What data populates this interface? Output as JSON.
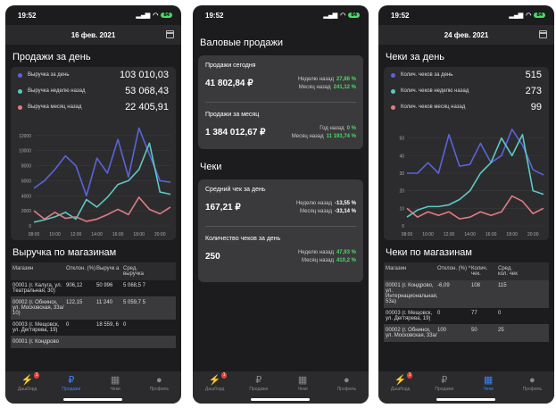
{
  "status": {
    "time": "19:52"
  },
  "colors": {
    "blue": "#5a63d8",
    "teal": "#5cc9c0",
    "red": "#e07b84",
    "green": "#4cd964"
  },
  "screen1": {
    "date": "16 фев. 2021",
    "title": "Продажи за день",
    "legend": [
      {
        "label": "Выручка за день",
        "value": "103 010,03"
      },
      {
        "label": "Выручка неделю назад",
        "value": "53 068,43"
      },
      {
        "label": "Выручка месяц назад",
        "value": "22 405,91"
      }
    ],
    "stores_title": "Выручка по магазинам",
    "table_headers": [
      "Магазин",
      "Отклон. (%)",
      "Выручк а",
      "Сред. выручка"
    ],
    "rows": [
      [
        "00001 (г. Калуга, ул. Театральная, 30)",
        "906,12",
        "50 996",
        "5 068,5 7"
      ],
      [
        "00002 (г. Обнинск, ул. Московская, 33а/ 10)",
        "122,15",
        "11 240",
        "5 059,7 5"
      ],
      [
        "00003 (г. Мещовск, ул. Дегтярева, 19)",
        "0",
        "18 559, 6",
        "0"
      ],
      [
        "00001 (г. Кондрово",
        "",
        "",
        ""
      ]
    ]
  },
  "chart1": {
    "type": "line",
    "x": [
      "08:00",
      "09:00",
      "10:00",
      "11:00",
      "12:00",
      "13:00",
      "14:00",
      "15:00",
      "16:00",
      "17:00",
      "18:00",
      "19:00",
      "20:00",
      "21:00"
    ],
    "ylim": [
      0,
      14000
    ],
    "yticks": [
      "0",
      "2000",
      "4000",
      "6000",
      "8000",
      "10000",
      "12000"
    ],
    "xticks": [
      "08:00",
      "10:00",
      "12:00",
      "14:00",
      "16:00",
      "18:00",
      "20:00"
    ],
    "series": [
      {
        "name": "Выручка за день",
        "values": [
          5000,
          6000,
          7500,
          9300,
          8000,
          4000,
          9000,
          7000,
          11500,
          6500,
          13000,
          9500,
          6000,
          5800
        ]
      },
      {
        "name": "Выручка неделю назад",
        "values": [
          500,
          800,
          1200,
          1800,
          900,
          3500,
          2500,
          3800,
          5500,
          6000,
          7500,
          11000,
          4500,
          4200
        ]
      },
      {
        "name": "Выручка месяц назад",
        "values": [
          2000,
          900,
          1800,
          1000,
          1200,
          600,
          900,
          1500,
          2200,
          1500,
          3800,
          2200,
          1600,
          2500
        ]
      }
    ]
  },
  "screen2": {
    "gross_title": "Валовые продажи",
    "today": {
      "title": "Продажи сегодня",
      "value": "41 802,84 ₽",
      "week_label": "Неделю назад",
      "week_val": "27,86 %",
      "month_label": "Месяц назад",
      "month_val": "241,12 %"
    },
    "month": {
      "title": "Продажи за месяц",
      "value": "1 384 012,67 ₽",
      "year_label": "Год назад",
      "year_val": "0 %",
      "month_label": "Месяц назад",
      "month_val": "11 193,74 %"
    },
    "checks_title": "Чеки",
    "avg": {
      "title": "Средний чек за день",
      "value": "167,21 ₽",
      "week_label": "Неделю назад",
      "week_val": "-13,55 %",
      "month_label": "Месяц назад",
      "month_val": "-33,14 %"
    },
    "count": {
      "title": "Количество чеков за день",
      "value": "250",
      "week_label": "Неделю назад",
      "week_val": "47,93 %",
      "month_label": "Месяц назад",
      "month_val": "410,2 %"
    }
  },
  "screen3": {
    "date": "24 фев. 2021",
    "title": "Чеки за день",
    "legend": [
      {
        "label": "Колич. чеков за день",
        "value": "515"
      },
      {
        "label": "Колич. чеков неделю назад",
        "value": "273"
      },
      {
        "label": "Колич. чеков месяц назад",
        "value": "99"
      }
    ],
    "stores_title": "Чеки по магазинам",
    "table_headers": [
      "Магазин",
      "Отклон. (%) ^",
      "Колич. чек.",
      "Сред. кол. чек"
    ],
    "rows": [
      [
        "00001 (г. Кондрово, ул. Интернациональная, 53а)",
        "-6,09",
        "108",
        "115"
      ],
      [
        "00003 (г. Мещовск, ул. Дегтярева, 19)",
        "0",
        "77",
        "0"
      ],
      [
        "00002 (г. Обнинск, ул. Московская, 33а/",
        "100",
        "50",
        "25"
      ]
    ]
  },
  "chart3": {
    "type": "line",
    "x": [
      "08:00",
      "09:00",
      "10:00",
      "11:00",
      "12:00",
      "13:00",
      "14:00",
      "15:00",
      "16:00",
      "17:00",
      "18:00",
      "19:00",
      "20:00",
      "21:00"
    ],
    "ylim": [
      0,
      60
    ],
    "yticks": [
      "0",
      "10",
      "20",
      "30",
      "40",
      "50"
    ],
    "xticks": [
      "08:00",
      "10:00",
      "12:00",
      "14:00",
      "16:00",
      "18:00",
      "20:00"
    ],
    "series": [
      {
        "name": "Колич. чеков за день",
        "values": [
          30,
          30,
          36,
          30,
          52,
          34,
          35,
          47,
          36,
          40,
          55,
          46,
          32,
          29
        ]
      },
      {
        "name": "Колич. чеков неделю назад",
        "values": [
          5,
          9,
          11,
          11,
          12,
          15,
          20,
          30,
          36,
          50,
          40,
          52,
          20,
          18
        ]
      },
      {
        "name": "Колич. чеков месяц назад",
        "values": [
          10,
          5,
          8,
          6,
          8,
          4,
          5,
          8,
          6,
          8,
          17,
          14,
          7,
          10
        ]
      }
    ]
  },
  "tabs": [
    {
      "label": "Дашборд",
      "badge": "1"
    },
    {
      "label": "Продажи"
    },
    {
      "label": "Чеки"
    },
    {
      "label": "Профиль"
    }
  ]
}
